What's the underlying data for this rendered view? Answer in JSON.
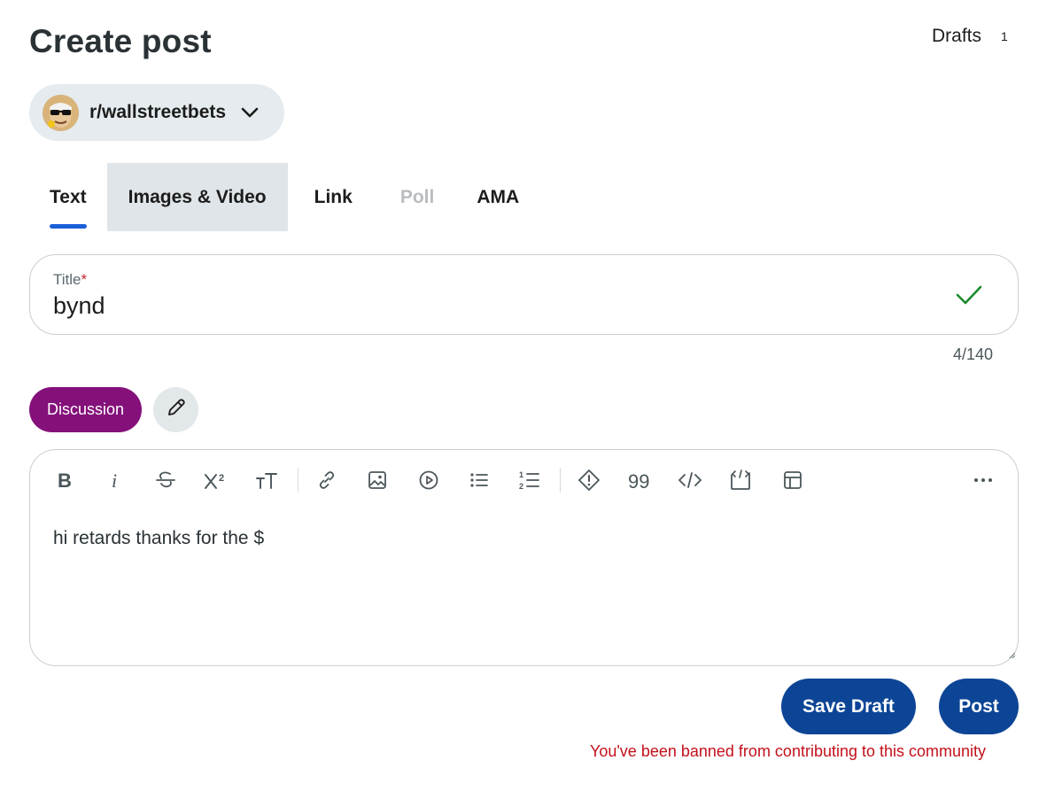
{
  "header": {
    "title": "Create post",
    "drafts_label": "Drafts",
    "drafts_count": "1"
  },
  "community": {
    "name": "r/wallstreetbets",
    "avatar_icon": "wsb-avatar",
    "chevron_icon": "chevron-down-icon"
  },
  "tabs": [
    {
      "label": "Text",
      "state": "active"
    },
    {
      "label": "Images & Video",
      "state": "hover"
    },
    {
      "label": "Link",
      "state": "normal"
    },
    {
      "label": "Poll",
      "state": "disabled"
    },
    {
      "label": "AMA",
      "state": "normal"
    }
  ],
  "title_field": {
    "label": "Title",
    "required_mark": "*",
    "value": "bynd",
    "valid_icon": "check-icon",
    "counter": "4/140"
  },
  "flair": {
    "label": "Discussion",
    "edit_icon": "pencil-icon"
  },
  "toolbar": {
    "tools": [
      "bold",
      "italic",
      "strikethrough",
      "superscript",
      "heading",
      "link",
      "image",
      "video",
      "bullet-list",
      "numbered-list",
      "spoiler",
      "quote",
      "code",
      "code-block",
      "table",
      "more"
    ]
  },
  "body": {
    "text": "hi retards thanks for the $"
  },
  "actions": {
    "save_draft_label": "Save Draft",
    "post_label": "Post"
  },
  "error": {
    "message": "You've been banned from contributing to this community"
  },
  "colors": {
    "accent": "#1b5fd8",
    "button": "#0d4596",
    "flair": "#84107a",
    "error": "#c3101a",
    "valid": "#1a8a2c"
  }
}
